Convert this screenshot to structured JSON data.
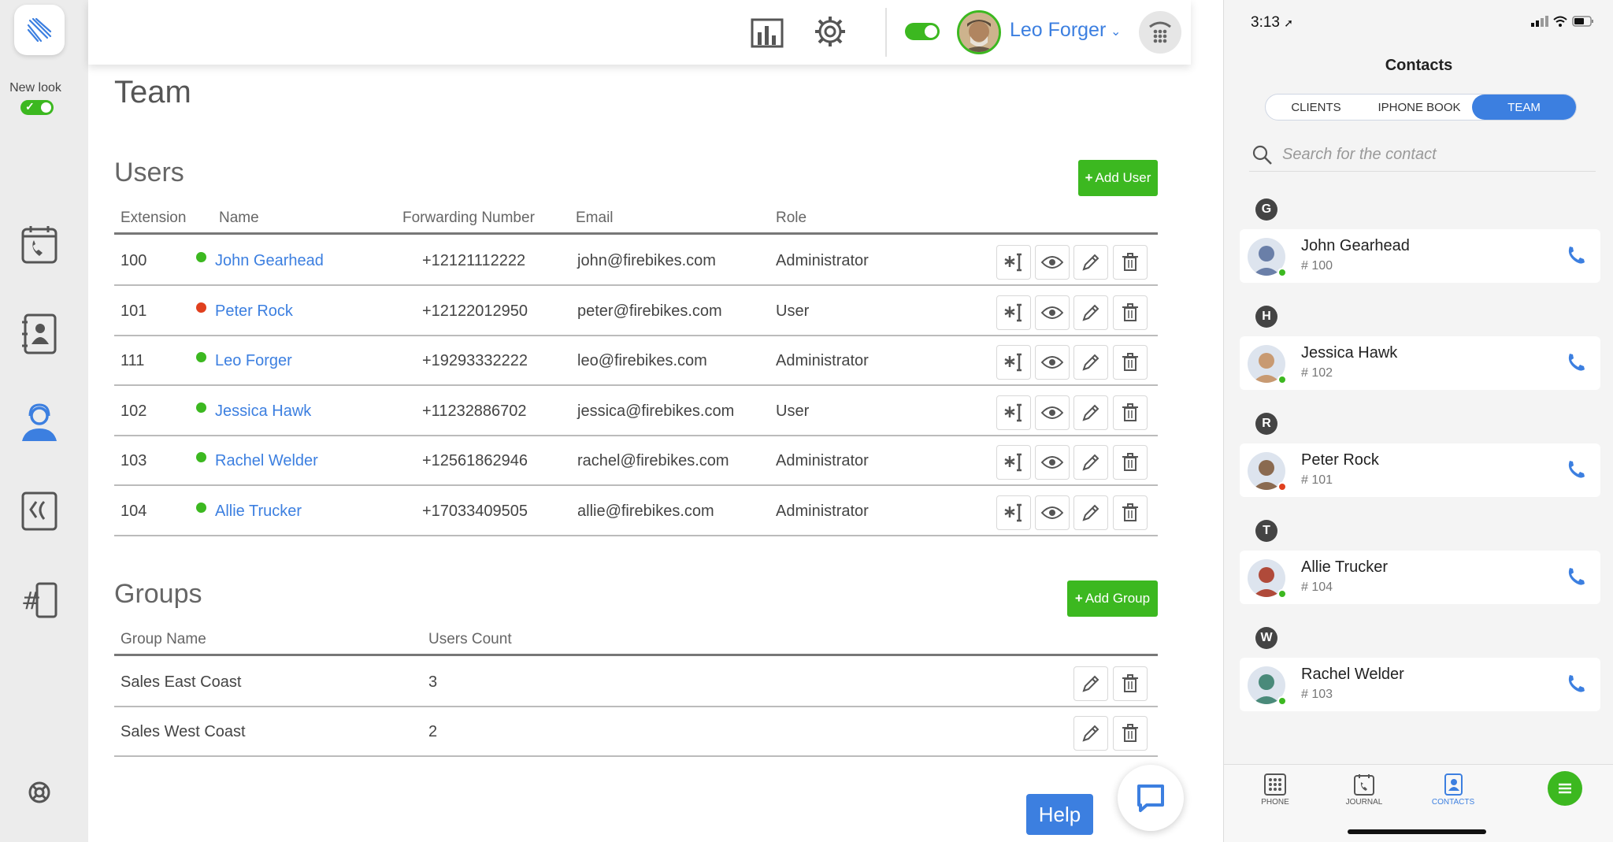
{
  "sidebar": {
    "new_look_label": "New look",
    "items": [
      "call-journal-icon",
      "contacts-icon",
      "team-icon",
      "call-flow-icon",
      "numbers-icon",
      "support-icon"
    ]
  },
  "topbar": {
    "user_name": "Leo Forger",
    "status_on": true
  },
  "page": {
    "title": "Team"
  },
  "users": {
    "title": "Users",
    "add_label": "Add User",
    "columns": [
      "Extension",
      "Name",
      "Forwarding Number",
      "Email",
      "Role"
    ],
    "rows": [
      {
        "ext": "100",
        "name": "John Gearhead",
        "number": "+12121112222",
        "email": "john@firebikes.com",
        "role": "Administrator",
        "status": "online"
      },
      {
        "ext": "101",
        "name": "Peter Rock",
        "number": "+12122012950",
        "email": "peter@firebikes.com",
        "role": "User",
        "status": "busy"
      },
      {
        "ext": "111",
        "name": "Leo Forger",
        "number": "+19293332222",
        "email": "leo@firebikes.com",
        "role": "Administrator",
        "status": "online"
      },
      {
        "ext": "102",
        "name": "Jessica Hawk",
        "number": "+11232886702",
        "email": "jessica@firebikes.com",
        "role": "User",
        "status": "online"
      },
      {
        "ext": "103",
        "name": "Rachel Welder",
        "number": "+12561862946",
        "email": "rachel@firebikes.com",
        "role": "Administrator",
        "status": "online"
      },
      {
        "ext": "104",
        "name": "Allie Trucker",
        "number": "+17033409505",
        "email": "allie@firebikes.com",
        "role": "Administrator",
        "status": "online"
      }
    ]
  },
  "groups": {
    "title": "Groups",
    "add_label": "Add Group",
    "columns": [
      "Group Name",
      "Users Count"
    ],
    "rows": [
      {
        "name": "Sales East Coast",
        "count": "3"
      },
      {
        "name": "Sales West Coast",
        "count": "2"
      }
    ]
  },
  "help_label": "Help",
  "phone": {
    "time": "3:13",
    "title": "Contacts",
    "segments": [
      "CLIENTS",
      "IPHONE BOOK",
      "TEAM"
    ],
    "active_segment": "TEAM",
    "search_placeholder": "Search for the contact",
    "groups": [
      {
        "letter": "G",
        "name": "John Gearhead",
        "ext": "# 100",
        "status": "online"
      },
      {
        "letter": "H",
        "name": "Jessica Hawk",
        "ext": "# 102",
        "status": "online"
      },
      {
        "letter": "R",
        "name": "Peter Rock",
        "ext": "# 101",
        "status": "busy"
      },
      {
        "letter": "T",
        "name": "Allie Trucker",
        "ext": "# 104",
        "status": "online"
      },
      {
        "letter": "W",
        "name": "Rachel Welder",
        "ext": "# 103",
        "status": "online"
      }
    ],
    "tabs": [
      "PHONE",
      "JOURNAL",
      "CONTACTS"
    ],
    "active_tab": "CONTACTS"
  },
  "colors": {
    "accent_blue": "#3c7fe0",
    "accent_green": "#3cb820",
    "status_online": "#3cb820",
    "status_busy": "#e0401e"
  }
}
